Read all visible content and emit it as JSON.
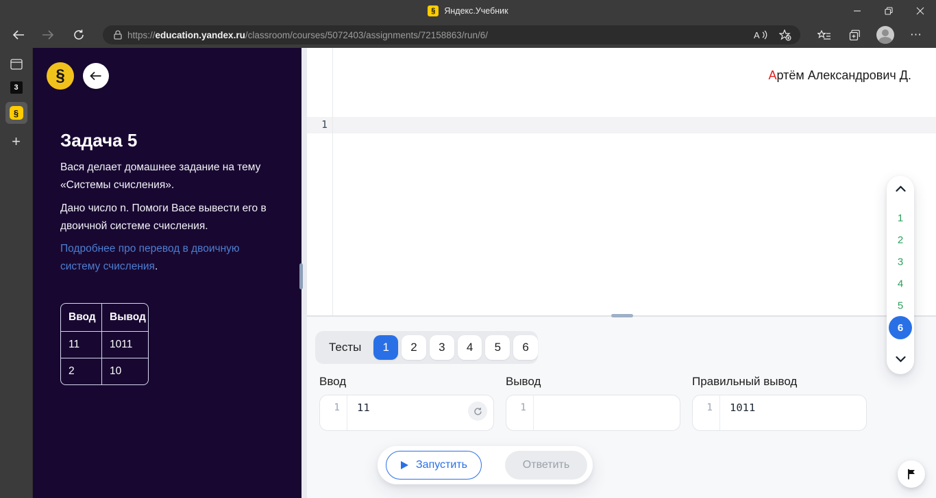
{
  "browser": {
    "tab": {
      "title": "Яндекс.Учебник",
      "favicon_glyph": "§"
    },
    "url_protocol": "https://",
    "url_domain": "education.yandex.ru",
    "url_path": "/classroom/courses/5072403/assignments/72158863/run/6/",
    "sidebar": {
      "tab3_badge": "3",
      "active_favicon_glyph": "§",
      "new_tab_glyph": "+"
    },
    "menu_dots": "⋯"
  },
  "task_panel": {
    "logo_glyph": "§",
    "title": "Задача 5",
    "paragraphs": [
      "Вася делает домашнее задание на тему «Системы счисления».",
      "Дано число n. Помоги Васе вывести его в двоичной системе счисления."
    ],
    "link_text": "Подробнее про перевод в двоичную систему счисления",
    "link_period": ".",
    "examples_table": {
      "headers": [
        "Ввод",
        "Вывод"
      ],
      "rows": [
        {
          "input": "11",
          "output": "1011"
        },
        {
          "input": "2",
          "output": "10"
        }
      ]
    }
  },
  "workspace": {
    "student_name_initial": "А",
    "student_name_rest": "ртём Александрович Д.",
    "editor_line_number": "1"
  },
  "test_navigator": {
    "numbers": [
      "1",
      "2",
      "3",
      "4",
      "5"
    ],
    "active_number": "6"
  },
  "tests_panel": {
    "tests_label": "Тесты",
    "tabs": [
      "1",
      "2",
      "3",
      "4",
      "5",
      "6"
    ],
    "active_tab": "1",
    "input": {
      "label": "Ввод",
      "line_number": "1",
      "value": "11"
    },
    "output": {
      "label": "Вывод",
      "line_number": "1",
      "value": ""
    },
    "expected": {
      "label": "Правильный вывод",
      "line_number": "1",
      "value": "1011"
    },
    "run_button": "Запустить",
    "answer_button": "Ответить"
  },
  "colors": {
    "accent_blue": "#2970e6",
    "link_blue": "#4d7ed2",
    "test_green": "#2aa05a",
    "panel_purple": "#180831",
    "name_initial_red": "#e01f1f"
  }
}
